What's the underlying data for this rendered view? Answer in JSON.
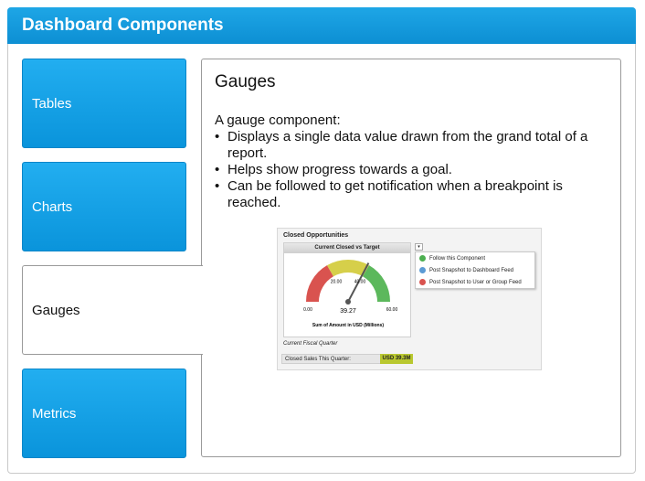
{
  "header": {
    "title": "Dashboard Components"
  },
  "tabs": [
    {
      "label": "Tables",
      "active": false
    },
    {
      "label": "Charts",
      "active": false
    },
    {
      "label": "Gauges",
      "active": true
    },
    {
      "label": "Metrics",
      "active": false
    }
  ],
  "content": {
    "title": "Gauges",
    "intro": "A gauge component:",
    "bullets": [
      "Displays a single data value drawn from the grand total of a report.",
      "Helps show progress towards a goal.",
      "Can be followed to get notification when a breakpoint is reached."
    ]
  },
  "screenshot": {
    "panel_title": "Closed Opportunities",
    "gauge_title": "Current Closed vs Target",
    "gauge": {
      "min": 0,
      "max": 60,
      "value": 39.27,
      "ticks": [
        "0.00",
        "20.00",
        "40.00",
        "60.00"
      ],
      "value_label": "39.27",
      "axis_label": "Sum of Amount in USD (Millions)",
      "colors": {
        "low": "#d9534f",
        "mid": "#d6cf4a",
        "high": "#5cb85c",
        "needle": "#555555"
      }
    },
    "menu": [
      {
        "label": "Follow this Component",
        "icon": "follow-icon",
        "color": "#4caf50"
      },
      {
        "label": "Post Snapshot to Dashboard Feed",
        "icon": "dashboard-feed-icon",
        "color": "#5b9bd5"
      },
      {
        "label": "Post Snapshot to User or Group Feed",
        "icon": "group-feed-icon",
        "color": "#d9534f"
      }
    ],
    "fiscal_label": "Current Fiscal Quarter",
    "closed_label": "Closed Sales This Quarter:",
    "closed_value": "USD 39.3M"
  },
  "colors": {
    "header": "#1a9fe0",
    "tab": "#1aa3e8"
  }
}
